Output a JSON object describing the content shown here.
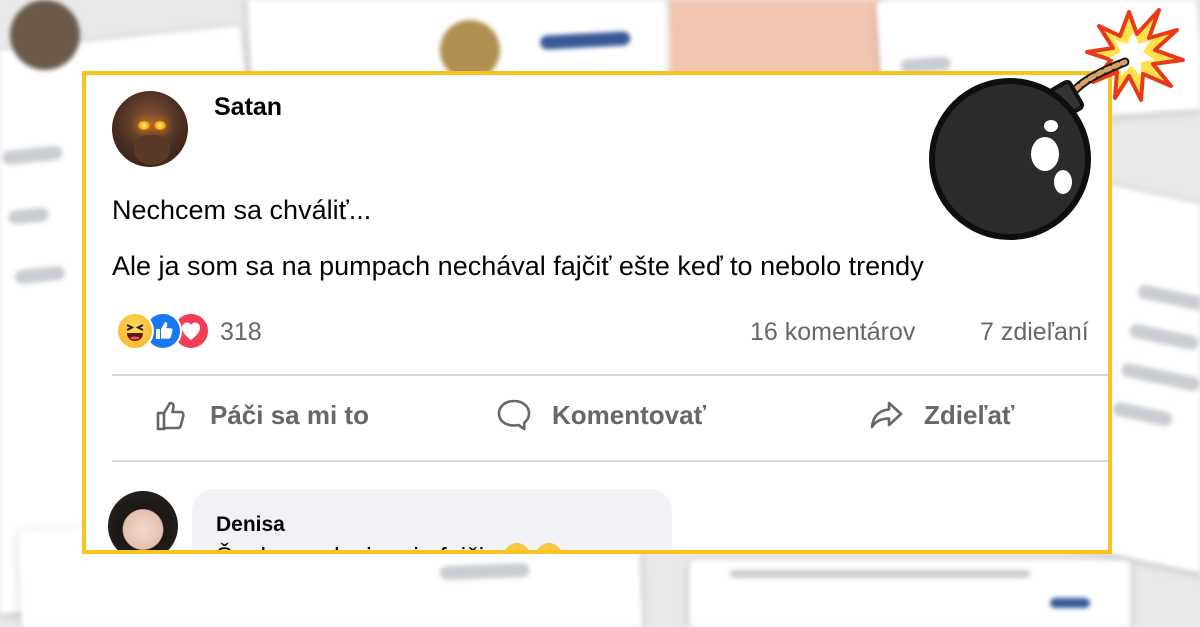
{
  "post": {
    "author": "Satan",
    "line1": "Nechcem sa chváliť...",
    "line2": "Ale ja som sa na pumpach nechával fajčiť ešte keď to nebolo trendy",
    "reaction_count": "318",
    "comments_count": "16 komentárov",
    "shares_count": "7 zdieľaní",
    "reactions": [
      "haha-icon",
      "like-icon",
      "love-icon"
    ]
  },
  "actions": {
    "like_label": "Páči sa mi to",
    "comment_label": "Komentovať",
    "share_label": "Zdieľať"
  },
  "comment": {
    "author": "Denisa",
    "text": "Špaky sa dusia, nie fajčia"
  },
  "colors": {
    "frame": "#f7c31c",
    "like_blue": "#1877f2",
    "love_red": "#f33e58",
    "haha_yellow": "#f7b125",
    "secondary_text": "#65676b"
  }
}
